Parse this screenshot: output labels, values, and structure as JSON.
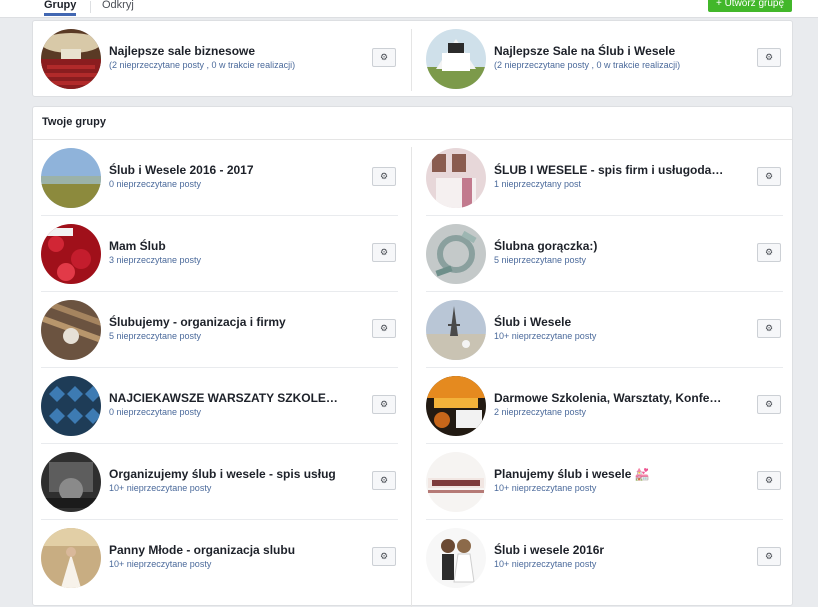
{
  "tabs": {
    "active": "Grupy",
    "inactive": "Odkryj"
  },
  "create_button": "+ Utwórz grupę",
  "recommended": [
    {
      "name": "Najlepsze sale biznesowe",
      "meta": "(2 nieprzeczytane posty , 0 w trakcie realizacji)"
    },
    {
      "name": "Najlepsze Sale na Ślub i Wesele",
      "meta": "(2 nieprzeczytane posty , 0 w trakcie realizacji)"
    }
  ],
  "your_groups": {
    "title": "Twoje grupy",
    "left": [
      {
        "name": "Ślub i Wesele 2016 - 2017",
        "meta": "0 nieprzeczytane posty"
      },
      {
        "name": "Mam Ślub",
        "meta": "3 nieprzeczytane posty"
      },
      {
        "name": "Ślubujemy - organizacja i firmy",
        "meta": "5 nieprzeczytane posty"
      },
      {
        "name": "NAJCIEKAWSZE WARSZATY SZKOLENIOWE",
        "meta": "0 nieprzeczytane posty"
      },
      {
        "name": "Organizujemy ślub i wesele - spis usług",
        "meta": "10+ nieprzeczytane posty"
      },
      {
        "name": "Panny Młode - organizacja slubu",
        "meta": "10+ nieprzeczytane posty"
      }
    ],
    "right": [
      {
        "name": "ŚLUB I WESELE - spis firm i usługodawców",
        "meta": "1 nieprzeczytany post"
      },
      {
        "name": "Ślubna gorączka:)",
        "meta": "5 nieprzeczytane posty"
      },
      {
        "name": "Ślub i Wesele",
        "meta": "10+ nieprzeczytane posty"
      },
      {
        "name": "Darmowe Szkolenia, Warsztaty, Konferencje",
        "meta": "2 nieprzeczytane posty"
      },
      {
        "name": "Planujemy ślub i wesele 💒",
        "meta": "10+ nieprzeczytane posty"
      },
      {
        "name": "Ślub i wesele 2016r",
        "meta": "10+ nieprzeczytane posty"
      }
    ]
  },
  "gear_icon": "⚙"
}
